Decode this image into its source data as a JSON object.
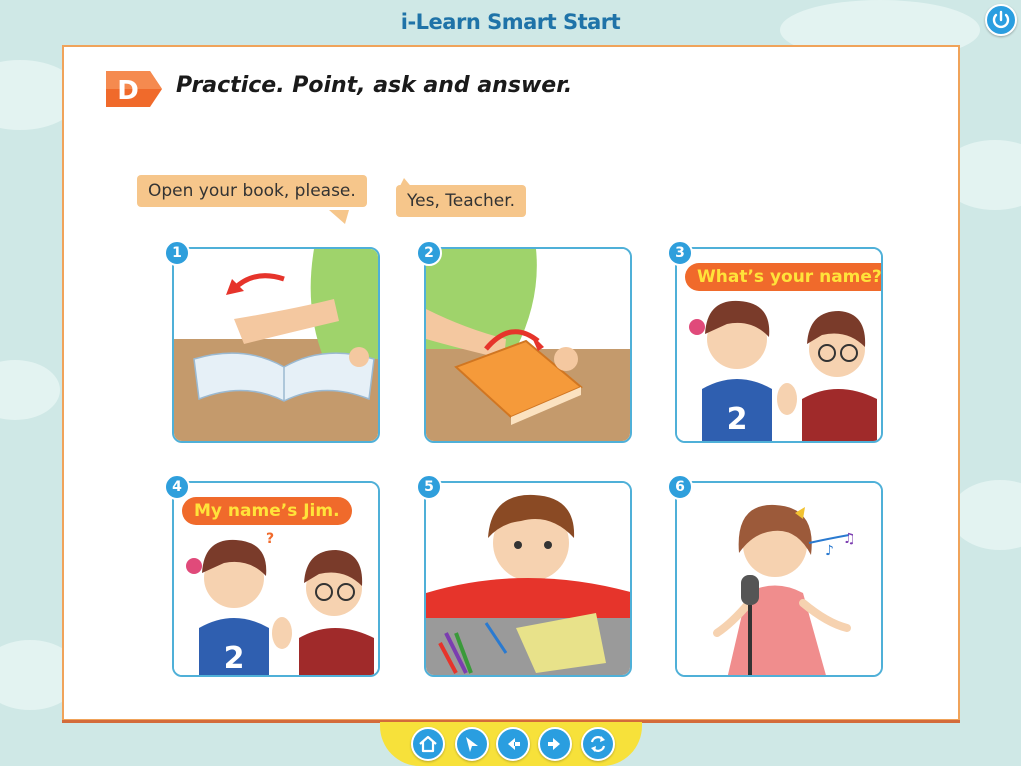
{
  "header": {
    "app_title": "i-Learn Smart Start"
  },
  "lesson": {
    "badge": "D",
    "instruction": "Practice. Point, ask and answer."
  },
  "model_dialogue": {
    "line_1": "Open your book, please.",
    "line_2": "Yes, Teacher."
  },
  "panels": [
    {
      "number": "1",
      "speech": ""
    },
    {
      "number": "2",
      "speech": ""
    },
    {
      "number": "3",
      "speech": "What’s your name?"
    },
    {
      "number": "4",
      "speech": "My name’s Jim."
    },
    {
      "number": "5",
      "speech": ""
    },
    {
      "number": "6",
      "speech": ""
    }
  ],
  "panel_shirt_number": "2",
  "icons": {
    "power": "power-icon",
    "home": "home-icon",
    "menu": "menu-icon",
    "back": "arrow-left-icon",
    "next": "arrow-right-icon",
    "reload": "reload-icon"
  },
  "colors": {
    "accent_blue": "#2a9ee0",
    "badge_orange": "#f06a2b",
    "speech_text_yellow": "#ffe33a",
    "page_border": "#f0a35a"
  }
}
